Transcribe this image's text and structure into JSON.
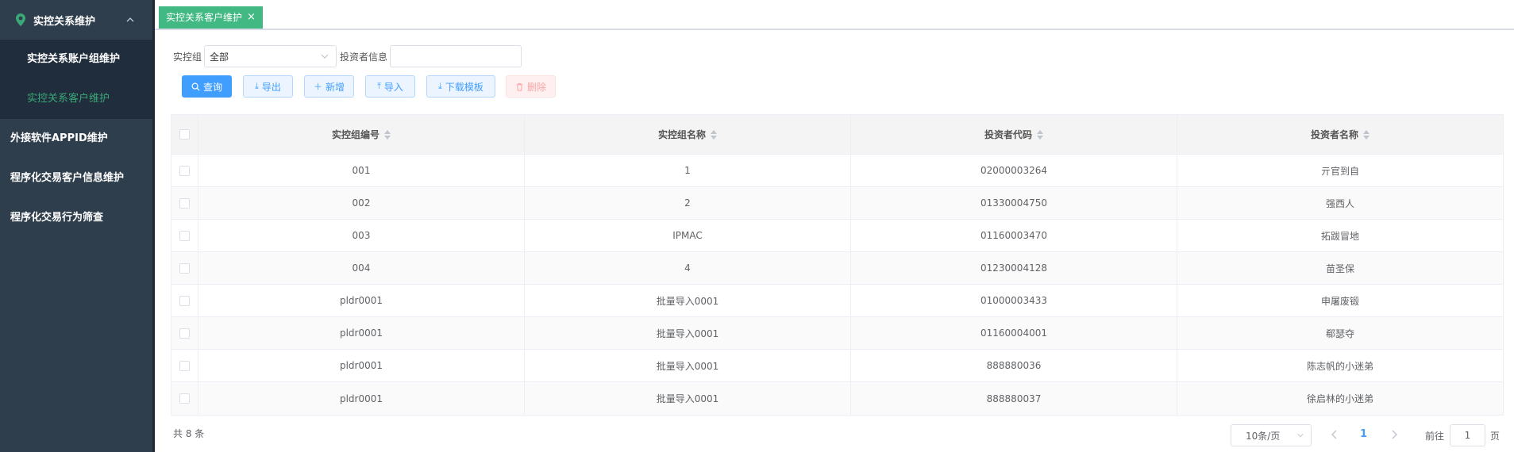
{
  "sidebar": {
    "group_label": "实控关系维护",
    "sub_items": [
      {
        "label": "实控关系账户组维护",
        "active": false
      },
      {
        "label": "实控关系客户维护",
        "active": true
      }
    ],
    "top_items": [
      {
        "label": "外接软件APPID维护"
      },
      {
        "label": "程序化交易客户信息维护"
      },
      {
        "label": "程序化交易行为筛查"
      }
    ]
  },
  "tabs": [
    {
      "label": "实控关系客户维护",
      "close": "×"
    }
  ],
  "filter": {
    "group_label": "实控组",
    "group_value": "全部",
    "investor_label": "投资者信息",
    "investor_value": "",
    "investor_placeholder": ""
  },
  "toolbar": {
    "query": "查询",
    "export": "导出",
    "add": "新增",
    "import": "导入",
    "download_template": "下载模板",
    "delete": "删除"
  },
  "table": {
    "columns": [
      "实控组编号",
      "实控组名称",
      "投资者代码",
      "投资者名称"
    ],
    "rows": [
      [
        "001",
        "1",
        "02000003264",
        "亓官到自"
      ],
      [
        "002",
        "2",
        "01330004750",
        "强西人"
      ],
      [
        "003",
        "IPMAC",
        "01160003470",
        "拓跋冒地"
      ],
      [
        "004",
        "4",
        "01230004128",
        "苗圣保"
      ],
      [
        "pldr0001",
        "批量导入0001",
        "01000003433",
        "申屠废锻"
      ],
      [
        "pldr0001",
        "批量导入0001",
        "01160004001",
        "郗瑟夺"
      ],
      [
        "pldr0001",
        "批量导入0001",
        "888880036",
        "陈志帆的小迷弟"
      ],
      [
        "pldr0001",
        "批量导入0001",
        "888880037",
        "徐启林的小迷弟"
      ]
    ]
  },
  "pagination": {
    "total_text": "共 8 条",
    "page_size": "10条/页",
    "current_page": "1",
    "goto_label": "前往",
    "goto_value": "1",
    "page_unit": "页"
  },
  "colors": {
    "sidebar_bg": "#2f3e4c",
    "active_green": "#3ba877",
    "tab_green": "#42b983",
    "primary_blue": "#409eff"
  }
}
